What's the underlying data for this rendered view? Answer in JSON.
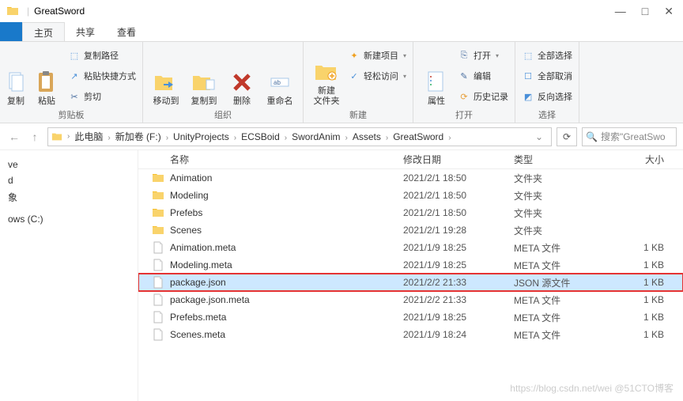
{
  "window": {
    "title": "GreatSword",
    "minimize": "—",
    "maximize": "□",
    "close": "✕"
  },
  "tabs": {
    "file": "",
    "home": "主页",
    "share": "共享",
    "view": "查看"
  },
  "ribbon": {
    "clipboard": {
      "label": "剪贴板",
      "copy": "复制",
      "paste": "粘贴",
      "copy_path": "复制路径",
      "paste_shortcut": "粘贴快捷方式",
      "cut": "剪切"
    },
    "organize": {
      "label": "组织",
      "move_to": "移动到",
      "copy_to": "复制到",
      "delete": "删除",
      "rename": "重命名"
    },
    "new": {
      "label": "新建",
      "new_folder": "新建\n文件夹",
      "new_item": "新建项目",
      "easy_access": "轻松访问"
    },
    "open": {
      "label": "打开",
      "properties": "属性",
      "open": "打开",
      "edit": "编辑",
      "history": "历史记录"
    },
    "select": {
      "label": "选择",
      "select_all": "全部选择",
      "select_none": "全部取消",
      "invert": "反向选择"
    }
  },
  "breadcrumb": {
    "items": [
      "此电脑",
      "新加卷 (F:)",
      "UnityProjects",
      "ECSBoid",
      "SwordAnim",
      "Assets",
      "GreatSword"
    ]
  },
  "search": {
    "placeholder": "搜索\"GreatSwo"
  },
  "sidebar": {
    "items": [
      "ve",
      "d",
      "象",
      "",
      "ows (C:)"
    ]
  },
  "columns": {
    "name": "名称",
    "date": "修改日期",
    "type": "类型",
    "size": "大小"
  },
  "files": [
    {
      "icon": "folder",
      "name": "Animation",
      "date": "2021/2/1 18:50",
      "type": "文件夹",
      "size": ""
    },
    {
      "icon": "folder",
      "name": "Modeling",
      "date": "2021/2/1 18:50",
      "type": "文件夹",
      "size": ""
    },
    {
      "icon": "folder",
      "name": "Prefebs",
      "date": "2021/2/1 18:50",
      "type": "文件夹",
      "size": ""
    },
    {
      "icon": "folder",
      "name": "Scenes",
      "date": "2021/2/1 19:28",
      "type": "文件夹",
      "size": ""
    },
    {
      "icon": "file",
      "name": "Animation.meta",
      "date": "2021/1/9 18:25",
      "type": "META 文件",
      "size": "1 KB"
    },
    {
      "icon": "file",
      "name": "Modeling.meta",
      "date": "2021/1/9 18:25",
      "type": "META 文件",
      "size": "1 KB"
    },
    {
      "icon": "file",
      "name": "package.json",
      "date": "2021/2/2 21:33",
      "type": "JSON 源文件",
      "size": "1 KB",
      "selected": true,
      "highlighted": true
    },
    {
      "icon": "file",
      "name": "package.json.meta",
      "date": "2021/2/2 21:33",
      "type": "META 文件",
      "size": "1 KB"
    },
    {
      "icon": "file",
      "name": "Prefebs.meta",
      "date": "2021/1/9 18:25",
      "type": "META 文件",
      "size": "1 KB"
    },
    {
      "icon": "file",
      "name": "Scenes.meta",
      "date": "2021/1/9 18:24",
      "type": "META 文件",
      "size": "1 KB"
    }
  ],
  "watermark": "https://blog.csdn.net/wei   @51CTO博客"
}
